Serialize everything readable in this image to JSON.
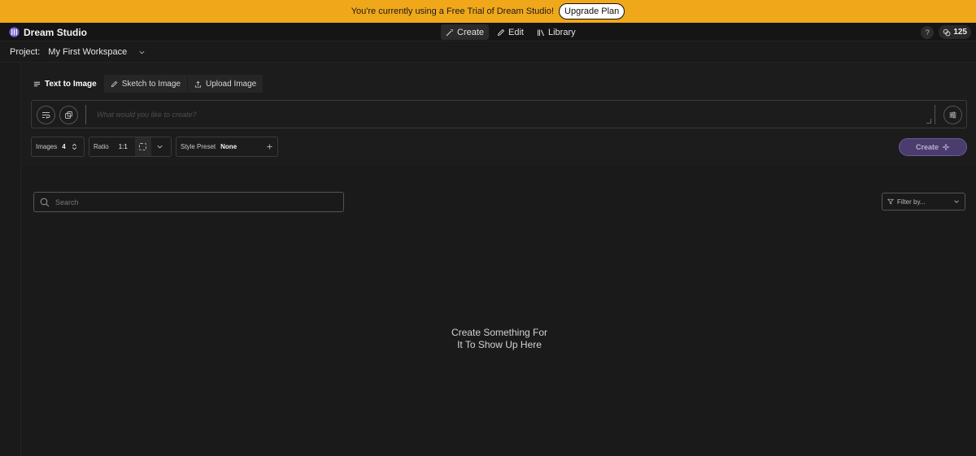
{
  "banner": {
    "message": "You're currently using a Free Trial of Dream Studio!",
    "upgrade_label": "Upgrade Plan",
    "color": "#f0a81a"
  },
  "header": {
    "brand": "Dream Studio",
    "nav": [
      {
        "label": "Create",
        "icon": "wand-icon",
        "active": true
      },
      {
        "label": "Edit",
        "icon": "pencil-icon",
        "active": false
      },
      {
        "label": "Library",
        "icon": "library-icon",
        "active": false
      }
    ],
    "help_label": "?",
    "credits": "125"
  },
  "project": {
    "label": "Project:",
    "name": "My First Workspace"
  },
  "generator": {
    "tabs": [
      {
        "label": "Text to Image",
        "icon": "lines-icon",
        "active": true
      },
      {
        "label": "Sketch to Image",
        "icon": "pencil-icon",
        "active": false
      },
      {
        "label": "Upload Image",
        "icon": "upload-icon",
        "active": false
      }
    ],
    "prompt_placeholder": "What would you like to create?",
    "images_label": "Images",
    "images_value": "4",
    "ratio_label": "Ratio",
    "ratio_value": "1:1",
    "style_label": "Style Preset",
    "style_value": "None",
    "create_label": "Create",
    "accent": "#4a3d6e"
  },
  "gallery": {
    "search_placeholder": "Search",
    "filter_label": "Filter by...",
    "empty_line1": "Create Something For",
    "empty_line2": "It To Show Up Here"
  }
}
